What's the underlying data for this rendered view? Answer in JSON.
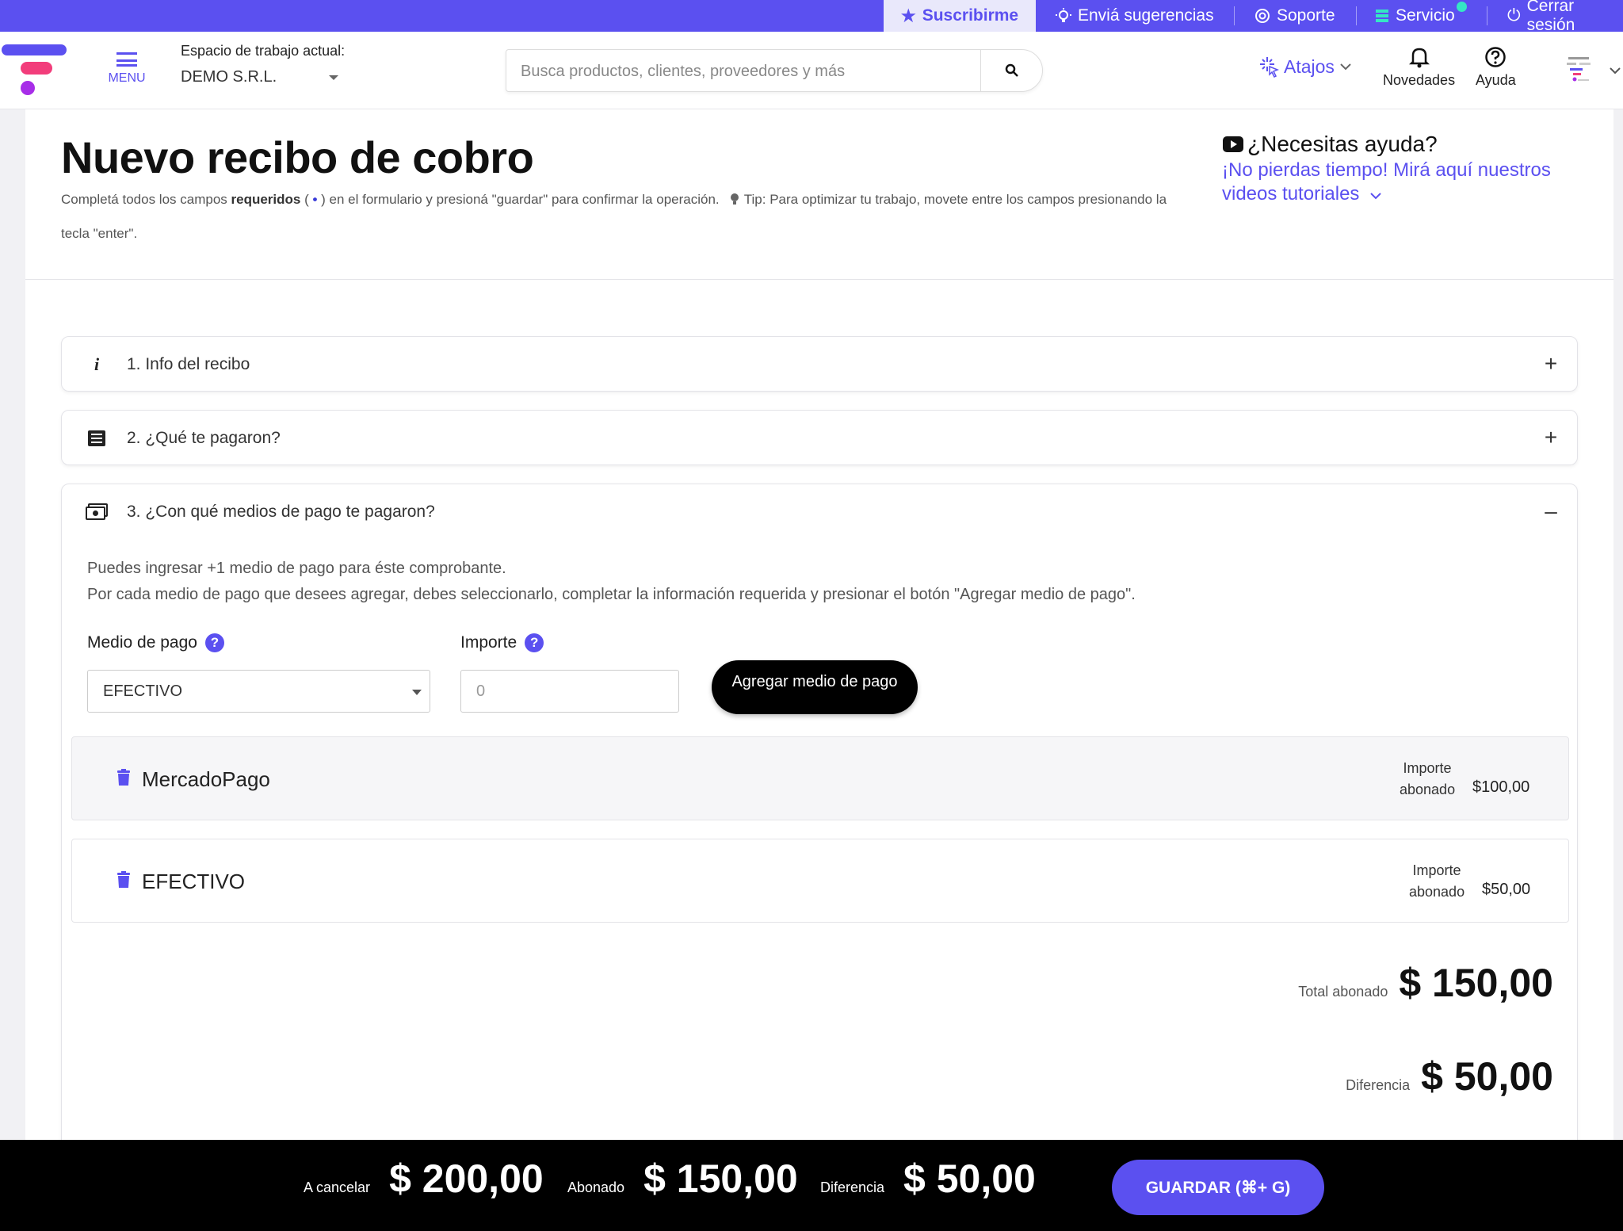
{
  "topbar": {
    "subscribe": "Suscribirme",
    "suggest": "Enviá sugerencias",
    "support": "Soporte",
    "service": "Servicio",
    "logout": "Cerrar sesión"
  },
  "header": {
    "menu_label": "MENU",
    "workspace_label": "Espacio de trabajo actual:",
    "workspace_value": "DEMO S.R.L.",
    "search_placeholder": "Busca productos, clientes, proveedores y más",
    "shortcuts": "Atajos",
    "news": "Novedades",
    "help": "Ayuda"
  },
  "page": {
    "title": "Nuevo recibo de cobro",
    "intro_1": "Completá todos los campos ",
    "intro_bold": "requeridos",
    "intro_2": " ( ",
    "intro_dot": "•",
    "intro_3": " )    en el formulario y presioná \"guardar\" para confirmar la operación.",
    "intro_tip": " Tip: Para optimizar tu trabajo, movete entre los campos presionando la tecla \"enter\".",
    "help_title": "¿Necesitas ayuda?",
    "help_link": "¡No pierdas tiempo! Mirá aquí nuestros videos tutoriales"
  },
  "sections": [
    {
      "label": "1. Info del recibo",
      "toggle": "+"
    },
    {
      "label": "2. ¿Qué te pagaron?",
      "toggle": "+"
    },
    {
      "label": "3. ¿Con qué medios de pago te pagaron?",
      "toggle": "–"
    }
  ],
  "payment": {
    "desc_1": "Puedes ingresar +1 medio de pago para éste comprobante.",
    "desc_2": "Por cada medio de pago que desees agregar, debes seleccionarlo, completar la información requerida y presionar el botón \"Agregar medio de pago\".",
    "method_label": "Medio de pago",
    "amount_label": "Importe",
    "method_value": "EFECTIVO",
    "amount_placeholder": "0",
    "add_button": "Agregar medio de pago",
    "items": [
      {
        "name": "MercadoPago",
        "label_1": "Importe",
        "label_2": "abonado",
        "value": "$100,00"
      },
      {
        "name": "EFECTIVO",
        "label_1": "Importe",
        "label_2": "abonado",
        "value": "$50,00"
      }
    ],
    "total_label": "Total abonado",
    "total_value": "$ 150,00",
    "diff_label": "Diferencia",
    "diff_value": "$ 50,00"
  },
  "footer": {
    "to_pay_label": "A cancelar",
    "to_pay_value": "$ 200,00",
    "paid_label": "Abonado",
    "paid_value": "$ 150,00",
    "diff_label": "Diferencia",
    "diff_value": "$ 50,00",
    "save_button": "GUARDAR (⌘+ G)"
  },
  "colors": {
    "brand": "#5b50f0",
    "accent_pink": "#f23d7b",
    "status_dot": "#35e6c5"
  }
}
